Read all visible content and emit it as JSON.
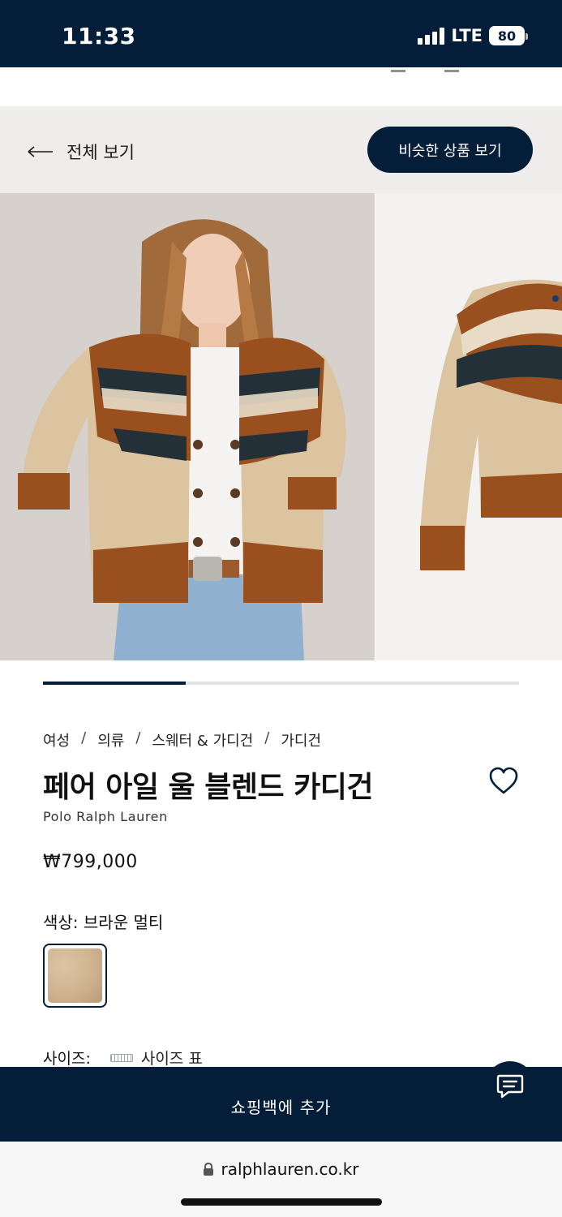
{
  "status_bar": {
    "time": "11:33",
    "network": "LTE",
    "battery": "80"
  },
  "nav": {
    "back_label": "전체 보기",
    "similar_button": "비슷한 상품 보기"
  },
  "gallery": {
    "image_count": 2,
    "progress": 0.3
  },
  "breadcrumb": [
    "여성",
    "의류",
    "스웨터 & 가디건",
    "가디건"
  ],
  "breadcrumb_separator": "/",
  "product": {
    "title": "페어 아일 울 블렌드 카디건",
    "brand": "Polo Ralph Lauren",
    "price": "₩799,000",
    "color_label": "색상: 브라운 멀티",
    "swatch_color": "#cfb38f",
    "size_label": "사이즈:",
    "size_chart_label": "사이즈 표"
  },
  "cta": {
    "add_to_bag": "쇼핑백에 추가"
  },
  "browser": {
    "url": "ralphlauren.co.kr"
  },
  "colors": {
    "navy": "#041e3a",
    "background_gray": "#efedeb",
    "knit_brown": "#9a4f1e",
    "knit_cream": "#dcc4a0"
  },
  "icons": [
    "arrow-left-icon",
    "heart-icon",
    "ruler-icon",
    "chat-icon",
    "lock-icon"
  ]
}
